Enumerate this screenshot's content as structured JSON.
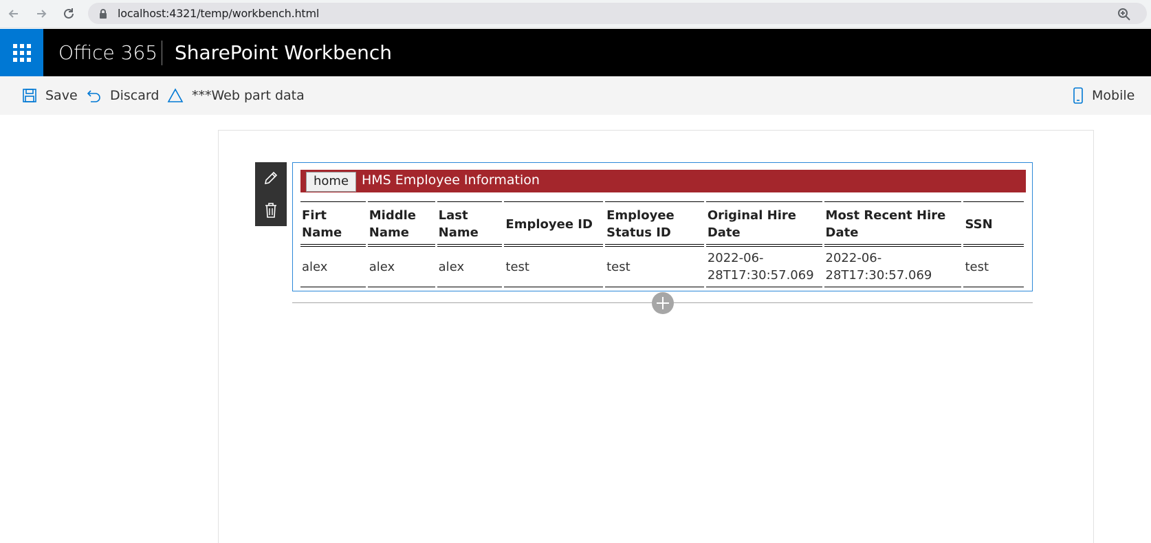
{
  "browser": {
    "url": "localhost:4321/temp/workbench.html"
  },
  "suite": {
    "brand": "Office 365",
    "product": "SharePoint Workbench"
  },
  "commands": {
    "save": "Save",
    "discard": "Discard",
    "webpart_data": "***Web part data",
    "mobile": "Mobile"
  },
  "webpart": {
    "home_button": "home",
    "title": "HMS Employee Information",
    "columns": [
      "Firt Name",
      "Middle Name",
      "Last Name",
      "Employee ID",
      "Employee Status ID",
      "Original Hire Date",
      "Most Recent Hire Date",
      "SSN"
    ],
    "rows": [
      [
        "alex",
        "alex",
        "alex",
        "test",
        "test",
        "2022-06-28T17:30:57.069",
        "2022-06-28T17:30:57.069",
        "test"
      ]
    ]
  },
  "colors": {
    "suite_bar": "#000000",
    "waffle": "#0078d4",
    "header_red": "#a4262c",
    "webpart_border": "#2b88d8"
  }
}
